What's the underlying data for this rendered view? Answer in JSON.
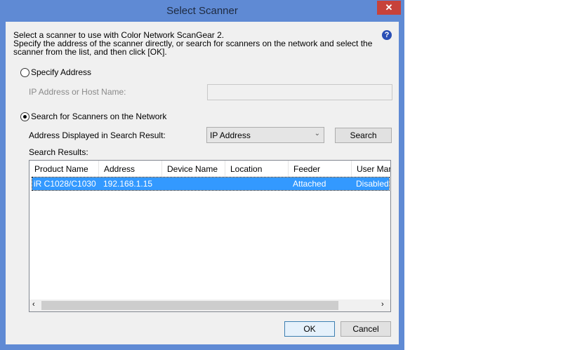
{
  "window": {
    "title": "Select Scanner",
    "close": "✕"
  },
  "intro": [
    "Select a scanner to use with Color Network ScanGear 2.",
    "Specify the address of the scanner directly, or search for scanners on the network and select the",
    "scanner from the list, and then click [OK]."
  ],
  "specify": {
    "label": "Specify Address",
    "ip_label": "IP Address or Host Name:",
    "ip_value": ""
  },
  "search": {
    "label": "Search for Scanners on the Network",
    "display_label": "Address Displayed in Search Result:",
    "display_value": "IP Address",
    "search_button": "Search",
    "results_label": "Search Results:"
  },
  "table": {
    "columns": [
      "Product Name",
      "Address",
      "Device Name",
      "Location",
      "Feeder",
      "User Man"
    ],
    "rows": [
      [
        "iR C1028/C1030",
        "192.168.1.15",
        "",
        "",
        "Attached",
        "Disabled"
      ]
    ]
  },
  "buttons": {
    "ok": "OK",
    "cancel": "Cancel"
  },
  "help": "?"
}
